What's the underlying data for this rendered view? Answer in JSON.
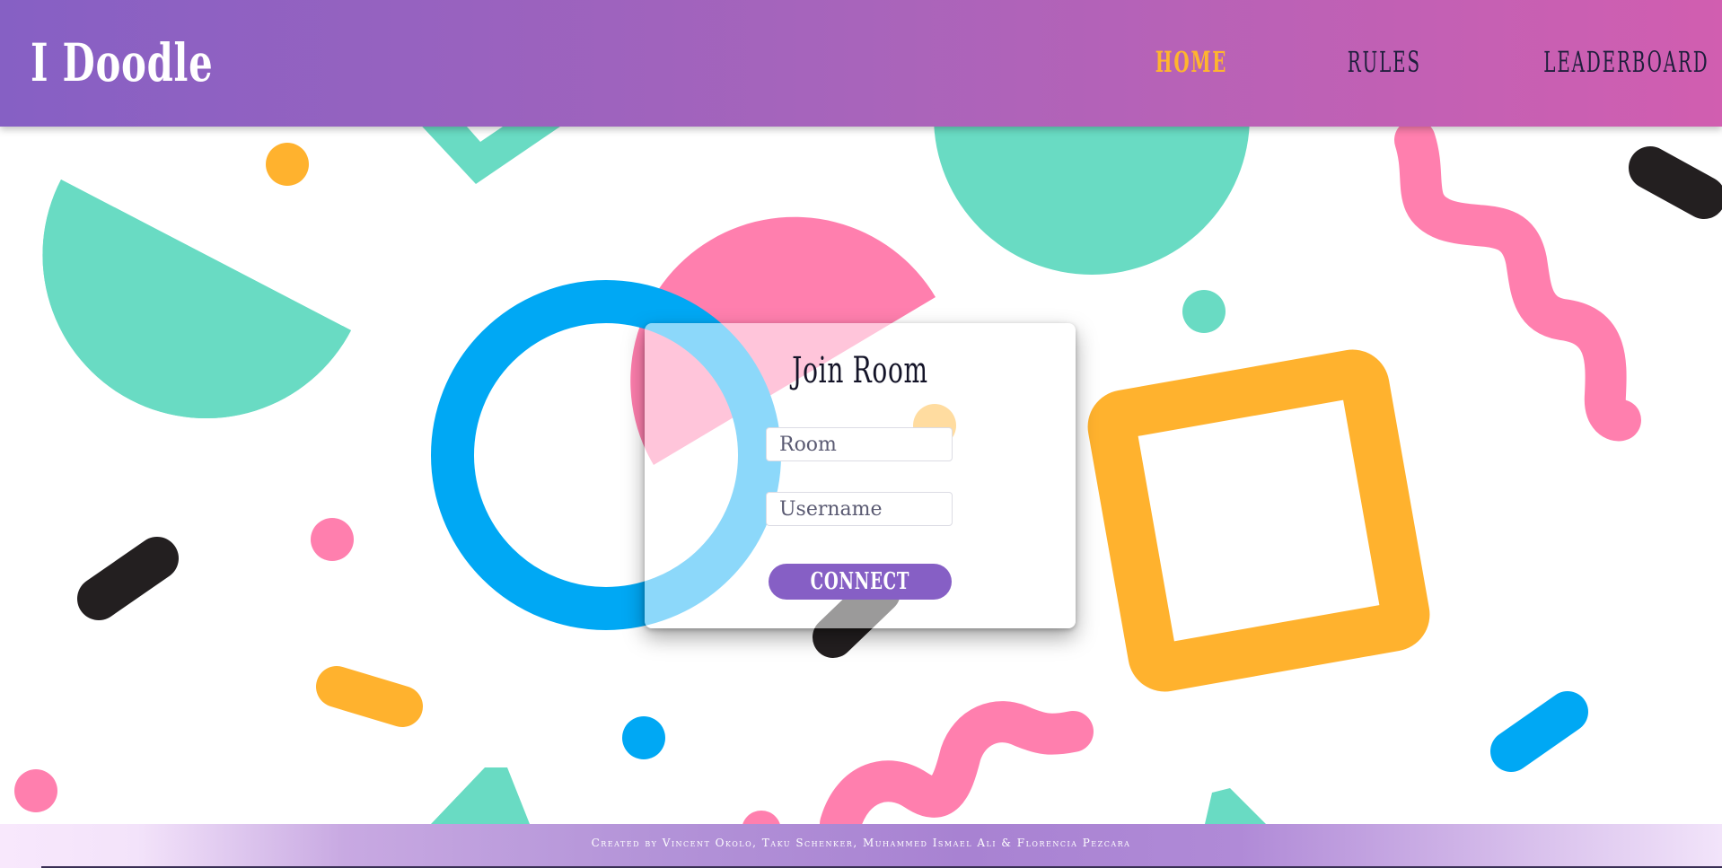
{
  "app": {
    "brand": "I Doodle"
  },
  "nav": {
    "home": "HOME",
    "rules": "RULES",
    "leaderboard": "LEADERBOARD"
  },
  "join_room": {
    "title": "Join Room",
    "room_placeholder": "Room",
    "username_placeholder": "Username",
    "connect_label": "CONNECT"
  },
  "footer": {
    "credits": "Created by Vincent Okolo, Taku Schenker, Muhammed Ismael Ali & Florencia Pezcara"
  },
  "colors": {
    "header_start": "#8660c4",
    "header_end": "#d15eb0",
    "nav_active": "#ffb52e",
    "connect_button": "#865fc5",
    "teal": "#69dbc3",
    "pink": "#ff7fae",
    "yellow": "#ffb22e",
    "blue": "#00a8f4",
    "black": "#231f20"
  },
  "decorations": {
    "shapes": [
      "teal-half-circle",
      "teal-semicircle-top",
      "pink-half-circle",
      "blue-ring",
      "yellow-square-frame",
      "pink-squiggle",
      "black-pill",
      "yellow-pill",
      "blue-pill",
      "dots"
    ]
  }
}
